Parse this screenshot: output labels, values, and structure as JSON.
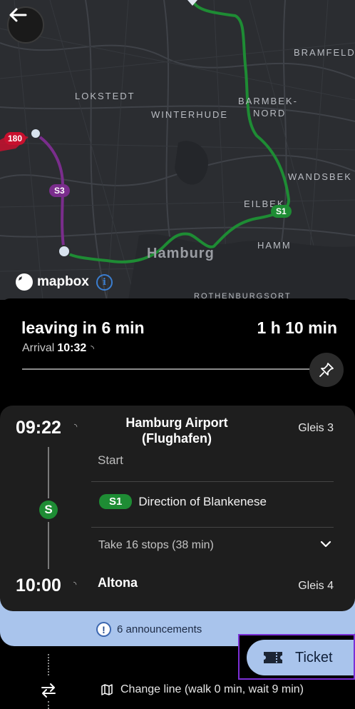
{
  "map": {
    "labels": {
      "bramfeld": "BRAMFELD",
      "lokstedt": "LOKSTEDT",
      "winterhude": "WINTERHUDE",
      "barmbek_1": "BARMBEK-",
      "barmbek_2": "NORD",
      "wandsbek": "WANDSBEK",
      "eilbek": "EILBEK",
      "hamm": "HAMM",
      "hamburg": "Hamburg",
      "rothenburgsort": "ROTHENBURGSORT"
    },
    "badges": {
      "s3": "S3",
      "s1": "S1",
      "bus": "180"
    },
    "attribution": "mapbox",
    "colors": {
      "s1": "#1e8c34",
      "s3": "#7a2d8c",
      "bus": "#c8102e"
    }
  },
  "summary": {
    "leaving": "leaving in 6 min",
    "duration": "1 h 10 min",
    "arrival_label": "Arrival",
    "arrival_time": "10:32"
  },
  "journey": {
    "departure_time": "09:22",
    "departure_stop": "Hamburg Airport (Flughafen)",
    "departure_platform": "Gleis 3",
    "start_label": "Start",
    "line": "S1",
    "direction": "Direction of Blankenese",
    "stops_summary": "Take 16 stops (38 min)",
    "arrival_time": "10:00",
    "arrival_stop": "Altona",
    "arrival_platform": "Gleis 4",
    "mode_letter": "S"
  },
  "announcements": {
    "label": "6 announcements"
  },
  "change": {
    "label": "Change line (walk 0 min, wait 9 min)"
  },
  "ticket": {
    "label": "Ticket"
  }
}
